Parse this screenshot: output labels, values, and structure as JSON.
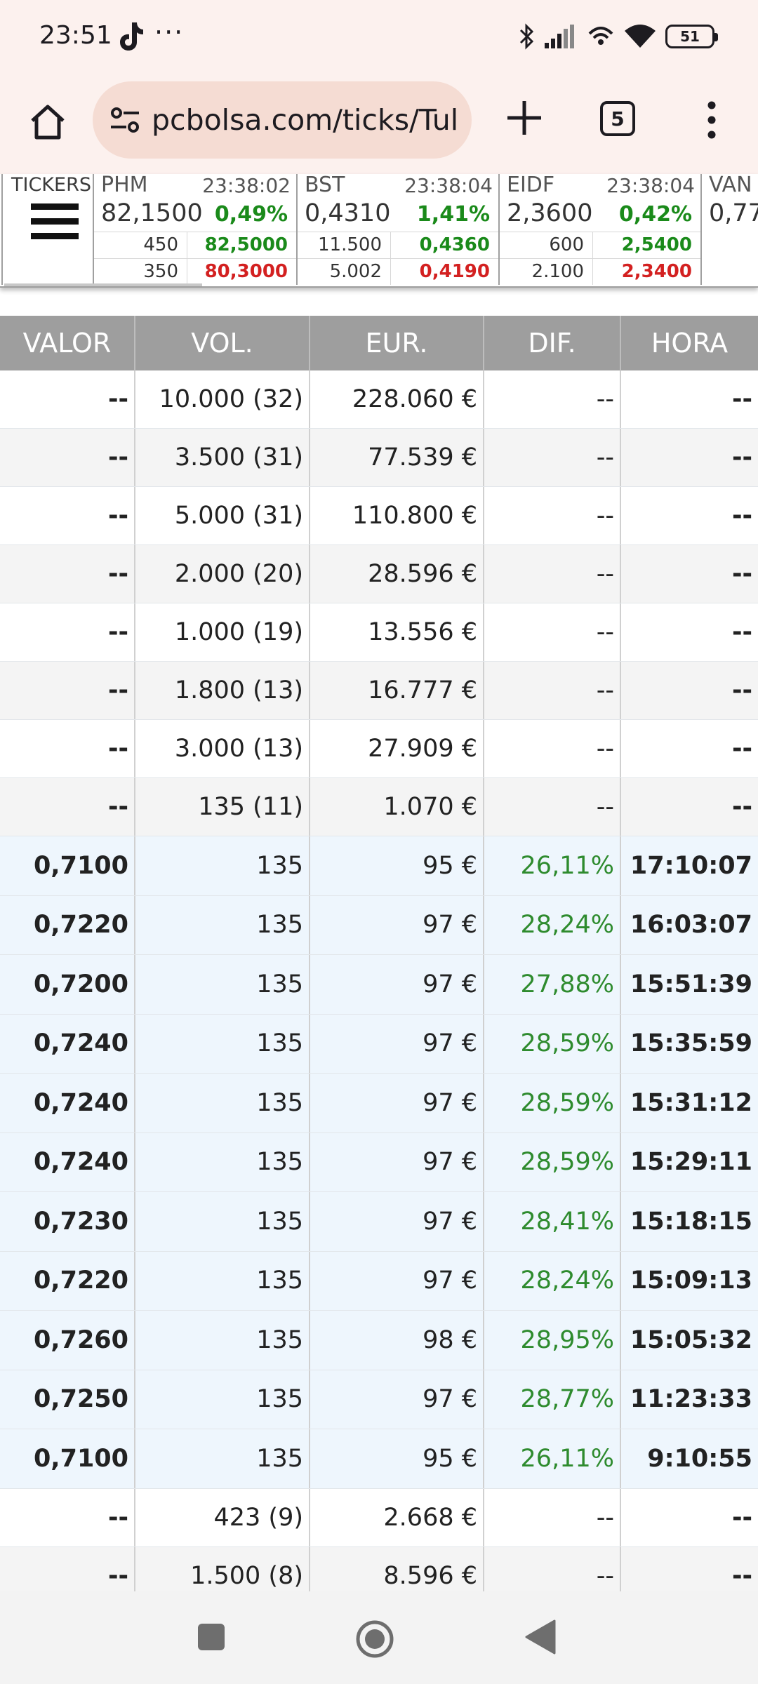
{
  "status_bar": {
    "time": "23:51",
    "notification_more": "···",
    "battery": "51",
    "icons": [
      "tiktok-icon",
      "bluetooth-icon",
      "signal-icon",
      "hotspot-icon",
      "wifi-icon",
      "battery-icon"
    ]
  },
  "browser": {
    "url": "pcbolsa.com/ticks/Tul",
    "tab_count": "5",
    "icons": [
      "home-icon",
      "site-settings-icon",
      "new-tab-icon",
      "tabs-icon",
      "more-menu-icon"
    ]
  },
  "tickers": {
    "label": "TICKERS",
    "items": [
      {
        "symbol": "PHM",
        "time": "23:38:02",
        "price": "82,1500",
        "change": "0,49%",
        "bid_qty": "450",
        "bid": "82,5000",
        "ask_qty": "350",
        "ask": "80,3000"
      },
      {
        "symbol": "BST",
        "time": "23:38:04",
        "price": "0,4310",
        "change": "1,41%",
        "bid_qty": "11.500",
        "bid": "0,4360",
        "ask_qty": "5.002",
        "ask": "0,4190"
      },
      {
        "symbol": "EIDF",
        "time": "23:38:04",
        "price": "2,3600",
        "change": "0,42%",
        "bid_qty": "600",
        "bid": "2,5400",
        "ask_qty": "2.100",
        "ask": "2,3400"
      }
    ],
    "partial": {
      "symbol": "VAN",
      "price": "0,77"
    }
  },
  "table": {
    "headers": [
      "VALOR",
      "VOL.",
      "EUR.",
      "DIF.",
      "HORA"
    ],
    "rows": [
      {
        "kind": "agg",
        "valor": "--",
        "vol": "10.000 (32)",
        "eur": "228.060 €",
        "dif": "--",
        "hora": "--"
      },
      {
        "kind": "agg",
        "valor": "--",
        "vol": "3.500 (31)",
        "eur": "77.539 €",
        "dif": "--",
        "hora": "--"
      },
      {
        "kind": "agg",
        "valor": "--",
        "vol": "5.000 (31)",
        "eur": "110.800 €",
        "dif": "--",
        "hora": "--"
      },
      {
        "kind": "agg",
        "valor": "--",
        "vol": "2.000 (20)",
        "eur": "28.596 €",
        "dif": "--",
        "hora": "--"
      },
      {
        "kind": "agg",
        "valor": "--",
        "vol": "1.000 (19)",
        "eur": "13.556 €",
        "dif": "--",
        "hora": "--"
      },
      {
        "kind": "agg",
        "valor": "--",
        "vol": "1.800 (13)",
        "eur": "16.777 €",
        "dif": "--",
        "hora": "--"
      },
      {
        "kind": "agg",
        "valor": "--",
        "vol": "3.000 (13)",
        "eur": "27.909 €",
        "dif": "--",
        "hora": "--"
      },
      {
        "kind": "agg",
        "valor": "--",
        "vol": "135 (11)",
        "eur": "1.070 €",
        "dif": "--",
        "hora": "--"
      },
      {
        "kind": "tick",
        "valor": "0,7100",
        "vol": "135",
        "eur": "95 €",
        "dif": "26,11%",
        "hora": "17:10:07"
      },
      {
        "kind": "tick",
        "valor": "0,7220",
        "vol": "135",
        "eur": "97 €",
        "dif": "28,24%",
        "hora": "16:03:07"
      },
      {
        "kind": "tick",
        "valor": "0,7200",
        "vol": "135",
        "eur": "97 €",
        "dif": "27,88%",
        "hora": "15:51:39"
      },
      {
        "kind": "tick",
        "valor": "0,7240",
        "vol": "135",
        "eur": "97 €",
        "dif": "28,59%",
        "hora": "15:35:59"
      },
      {
        "kind": "tick",
        "valor": "0,7240",
        "vol": "135",
        "eur": "97 €",
        "dif": "28,59%",
        "hora": "15:31:12"
      },
      {
        "kind": "tick",
        "valor": "0,7240",
        "vol": "135",
        "eur": "97 €",
        "dif": "28,59%",
        "hora": "15:29:11"
      },
      {
        "kind": "tick",
        "valor": "0,7230",
        "vol": "135",
        "eur": "97 €",
        "dif": "28,41%",
        "hora": "15:18:15"
      },
      {
        "kind": "tick",
        "valor": "0,7220",
        "vol": "135",
        "eur": "97 €",
        "dif": "28,24%",
        "hora": "15:09:13"
      },
      {
        "kind": "tick",
        "valor": "0,7260",
        "vol": "135",
        "eur": "98 €",
        "dif": "28,95%",
        "hora": "15:05:32"
      },
      {
        "kind": "tick",
        "valor": "0,7250",
        "vol": "135",
        "eur": "97 €",
        "dif": "28,77%",
        "hora": "11:23:33"
      },
      {
        "kind": "tick",
        "valor": "0,7100",
        "vol": "135",
        "eur": "95 €",
        "dif": "26,11%",
        "hora": "9:10:55"
      },
      {
        "kind": "agg",
        "valor": "--",
        "vol": "423 (9)",
        "eur": "2.668 €",
        "dif": "--",
        "hora": "--"
      },
      {
        "kind": "agg",
        "valor": "--",
        "vol": "1.500 (8)",
        "eur": "8.596 €",
        "dif": "--",
        "hora": "--"
      }
    ]
  },
  "colors": {
    "chrome_bg": "#fcf1ee",
    "url_pill": "#f5dcd3",
    "header_bg": "#9e9e9e",
    "tick_row_bg": "#eef6fd",
    "positive": "#1a8a1a",
    "negative": "#d32020"
  },
  "nav": {
    "icons": [
      "recents-icon",
      "home-circle-icon",
      "back-icon"
    ]
  }
}
